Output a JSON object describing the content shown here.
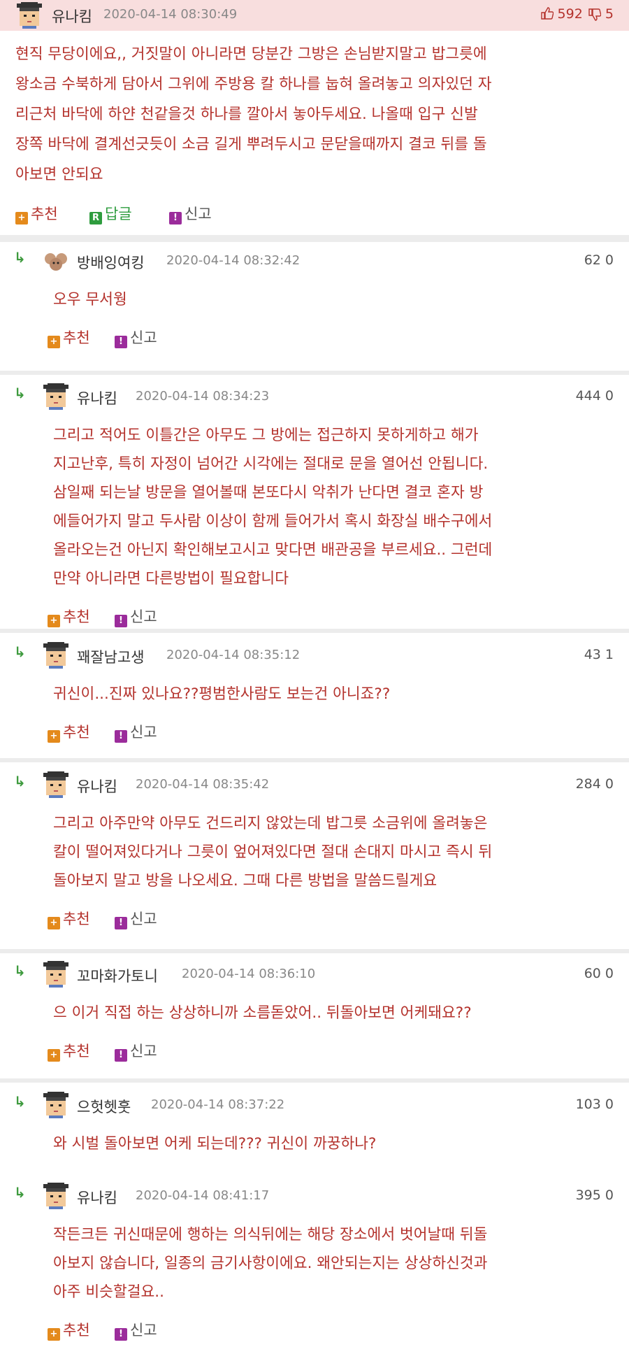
{
  "colors": {
    "text": "#b4322c",
    "header_bg": "#f8dede",
    "separator": "#ececec",
    "reply_arrow": "#3f9b3f",
    "recommend_icon": "#e48a1c",
    "reply_icon": "#2e9c3e",
    "report_icon": "#9b2c9b"
  },
  "icons": {
    "reply_arrow": "reply-arrow-icon",
    "thumbs_up": "thumbs-up-icon",
    "thumbs_down": "thumbs-down-icon",
    "recommend": "plus-icon",
    "reply": "r-icon",
    "report": "report-icon"
  },
  "top_comment": {
    "nick": "유나킴",
    "date": "2020-04-14 08:30:49",
    "up": "592",
    "down": "5",
    "lines": [
      "현직 무당이에요,, 거짓말이 아니라면 당분간 그방은 손님받지말고 밥그릇에",
      "왕소금 수북하게 담아서 그위에 주방용 칼 하나를 눕혀 올려놓고 의자있던 자",
      "리근처 바닥에 하얀 천같을것 하나를 깔아서 놓아두세요. 나올때 입구 신발",
      "장쪽 바닥에 결계선긋듯이 소금 길게 뿌려두시고 문닫을때까지 결코 뒤를 돌",
      "아보면 안되요"
    ],
    "recommend": "추천",
    "reply": "답글",
    "report": "신고"
  },
  "replies": [
    {
      "nick": "방배잉여킹",
      "date": "2020-04-14 08:32:42",
      "votes": "62 0",
      "lines": [
        "오우 무서웡"
      ],
      "recommend": "추천",
      "report": "신고"
    },
    {
      "nick": "유나킴",
      "date": "2020-04-14 08:34:23",
      "votes": "444 0",
      "lines": [
        "그리고 적어도 이틀간은 아무도 그 방에는 접근하지 못하게하고 해가",
        "지고난후, 특히 자정이 넘어간 시각에는 절대로 문을 열어선 안됩니다.",
        "삼일째 되는날 방문을 열어볼때 본또다시 악취가 난다면 결코 혼자 방",
        "에들어가지 말고 두사람 이상이 함께 들어가서 혹시 화장실 배수구에서",
        "올라오는건 아닌지 확인해보고시고 맞다면 배관공을 부르세요.. 그런데",
        "만약 아니라면 다른방법이 필요합니다"
      ],
      "recommend": "추천",
      "report": "신고"
    },
    {
      "nick": "꽤잘남고생",
      "date": "2020-04-14 08:35:12",
      "votes": "43 1",
      "lines": [
        "귀신이...진짜 있나요??평범한사람도 보는건 아니죠??"
      ],
      "recommend": "추천",
      "report": "신고"
    },
    {
      "nick": "유나킴",
      "date": "2020-04-14 08:35:42",
      "votes": "284 0",
      "lines": [
        "그리고 아주만약 아무도 건드리지 않았는데 밥그릇 소금위에 올려놓은",
        "칼이 떨어져있다거나 그릇이 엎어져있다면 절대 손대지 마시고 즉시 뒤",
        "돌아보지 말고 방을 나오세요. 그때 다른 방법을 말씀드릴게요"
      ],
      "recommend": "추천",
      "report": "신고"
    },
    {
      "nick": "꼬마화가토니",
      "date": "2020-04-14 08:36:10",
      "votes": "60 0",
      "lines": [
        "으 이거 직접 하는 상상하니까 소름돋았어.. 뒤돌아보면 어케돼요??"
      ],
      "recommend": "추천",
      "report": "신고"
    },
    {
      "nick": "으헛헷훗",
      "date": "2020-04-14 08:37:22",
      "votes": "103 0",
      "lines": [
        "와 시벌 돌아보면 어케 되는데??? 귀신이 까꿍하나?"
      ]
    },
    {
      "nick": "유나킴",
      "date": "2020-04-14 08:41:17",
      "votes": "395 0",
      "lines": [
        "작든크든 귀신때문에 행하는 의식뒤에는 해당 장소에서 벗어날때 뒤돌",
        "아보지 않습니다, 일종의 금기사항이에요. 왜안되는지는 상상하신것과",
        "아주 비슷할걸요.."
      ],
      "recommend": "추천",
      "report": "신고"
    }
  ]
}
